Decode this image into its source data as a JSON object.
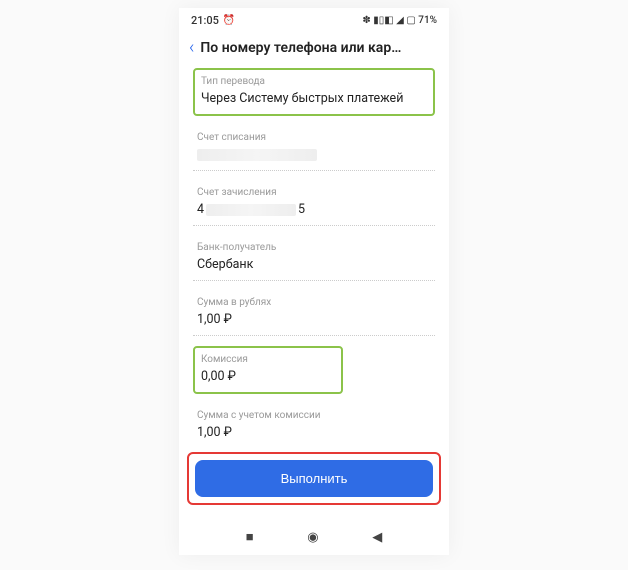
{
  "status": {
    "time": "21:05",
    "alarm_icon": "⏰",
    "right_icons": "✽ ▮▯◧ ◢ ▢ 71%"
  },
  "header": {
    "back_icon": "‹",
    "title": "По номеру телефона или кар…"
  },
  "fields": {
    "transfer_type": {
      "label": "Тип перевода",
      "value": "Через Систему быстрых платежей"
    },
    "debit_account": {
      "label": "Счет списания",
      "value": ""
    },
    "credit_account": {
      "label": "Счет зачисления",
      "prefix": "4",
      "suffix": "5"
    },
    "bank": {
      "label": "Банк-получатель",
      "value": "Сбербанк"
    },
    "amount": {
      "label": "Сумма в рублях",
      "value": "1,00 ₽"
    },
    "commission": {
      "label": "Комиссия",
      "value": "0,00 ₽"
    },
    "total": {
      "label": "Сумма с учетом комиссии",
      "value": "1,00 ₽"
    }
  },
  "button": {
    "execute": "Выполнить"
  },
  "nav": {
    "recent": "■",
    "home": "◉",
    "back": "◀"
  }
}
